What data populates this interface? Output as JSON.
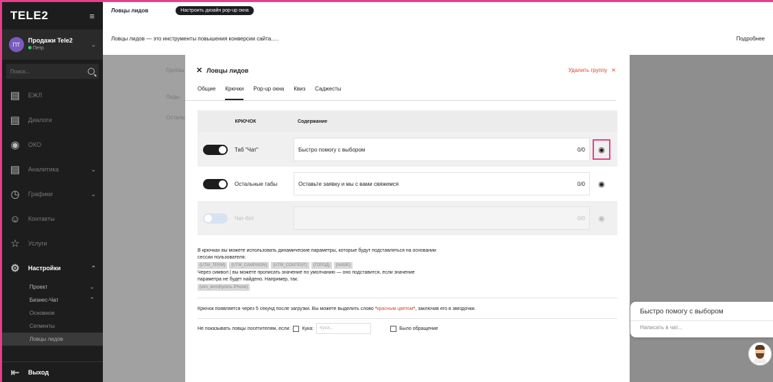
{
  "sidebar": {
    "logo": "TELE2",
    "account": {
      "initials": "ПТ",
      "name": "Продажи Tele2",
      "sub": "Петр"
    },
    "search_placeholder": "Поиск...",
    "items": [
      {
        "label": "ЕЖЛ",
        "icon": "document-icon"
      },
      {
        "label": "Диалоги",
        "icon": "chat-icon"
      },
      {
        "label": "ОКО",
        "icon": "eye-icon"
      },
      {
        "label": "Аналитика",
        "icon": "analytics-icon"
      },
      {
        "label": "Графики",
        "icon": "clock-icon"
      },
      {
        "label": "Контакты",
        "icon": "user-icon"
      },
      {
        "label": "Услуги",
        "icon": "star-icon"
      },
      {
        "label": "Настройки",
        "icon": "settings-icon"
      }
    ],
    "subitems": {
      "project": "Проект",
      "biz_chat": "Бизнес-Чат",
      "main": "Основное",
      "segments": "Сегменты",
      "lead_catchers": "Ловцы лидов"
    },
    "logout": "Выход"
  },
  "topbar": {
    "title": "Ловцы лидов",
    "button": "Настроить дизайн pop-up окна"
  },
  "infobar": {
    "text": "Ловцы лидов — это инструменты повышения конверсии сайта.....",
    "more": "Подробнее"
  },
  "background": {
    "col_a": "Группы",
    "col_b": "Лиды",
    "col_c": "Остальные"
  },
  "panel": {
    "title": "Ловцы лидов",
    "delete": "Удалить группу",
    "tabs": [
      "Общие",
      "Крючки",
      "Pop-up окна",
      "Квиз",
      "Саджесты"
    ],
    "table_head": {
      "hook": "КРЮЧОК",
      "content": "Содержание"
    },
    "hooks": [
      {
        "label": "Таб \"Чат\"",
        "value": "Быстро помогу с выбором",
        "count": "0/0"
      },
      {
        "label": "Остальные табы",
        "value": "Оставьте заявку и мы с вами свяжемся",
        "count": "0/0"
      },
      {
        "label": "Чат-бот",
        "value": "",
        "count": "0/0"
      }
    ],
    "info": {
      "line1": "В крючках вы можете использовать динамические параметры, которые будут подставляться на основании",
      "line2": "сессии пользователя:",
      "chips": [
        "{UTM_TERM}",
        "{UTM_CAMPAIGN}",
        "{UTM_CONTENT}",
        "{ГОРОД}",
        "{NAME}"
      ],
      "line3": "Через символ | вы можете прописать значение по умолчанию — оно подставится, если значение",
      "line4": "параметра не будет найдено. Например, так:",
      "example_chip": "{utm_term|Купить iPhone}"
    },
    "note_before": "Крючок появляется через 5 секунд после загрузки. Вы можете выделить слово *",
    "note_red": "красным цветом",
    "note_after": "*, заключив его в звездочки.",
    "filter": {
      "label": "Не показывать ловцы посетителям, если:",
      "cookie": "Кука:",
      "cookie_placeholder": "Кука...",
      "was_contact": "Было обращение"
    }
  },
  "chat": {
    "message": "Быстро помогу с выбором",
    "write": "Написать в чат..."
  }
}
